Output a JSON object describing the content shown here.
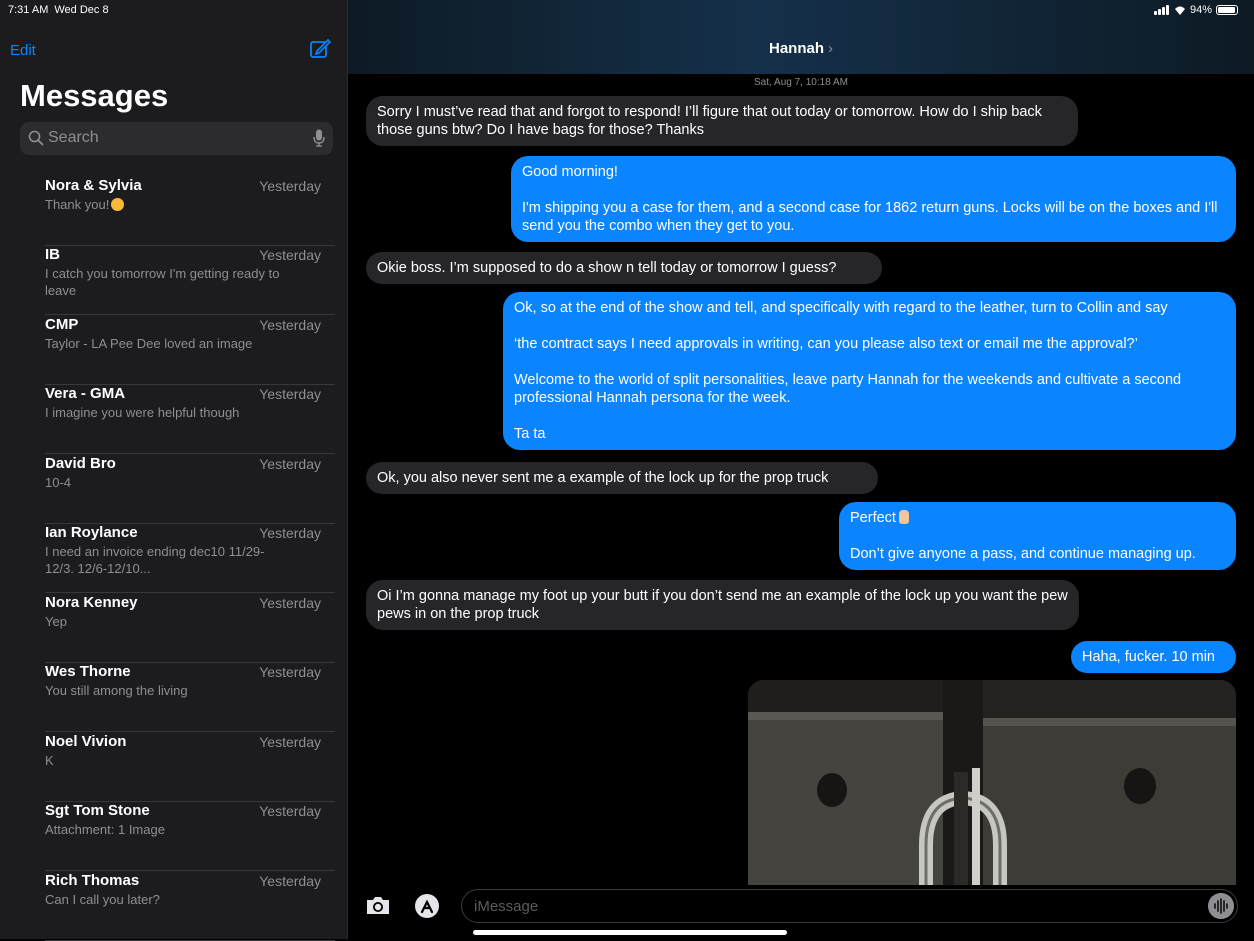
{
  "status": {
    "time": "7:31 AM",
    "date": "Wed Dec 8",
    "battery": "94%",
    "battery_level": 0.94
  },
  "sidebar": {
    "edit_label": "Edit",
    "title": "Messages",
    "search_placeholder": "Search",
    "conversations": [
      {
        "name": "Nora & Sylvia",
        "time": "Yesterday",
        "preview": "Thank you!"
      },
      {
        "name": "IB",
        "time": "Yesterday",
        "preview": "I catch you tomorrow I'm getting ready to leave"
      },
      {
        "name": "CMP",
        "time": "Yesterday",
        "preview": "Taylor - LA Pee Dee loved an image"
      },
      {
        "name": "Vera - GMA",
        "time": "Yesterday",
        "preview": "I imagine you were helpful though"
      },
      {
        "name": "David Bro",
        "time": "Yesterday",
        "preview": "10-4"
      },
      {
        "name": "Ian Roylance",
        "time": "Yesterday",
        "preview": "I need an invoice ending dec10 11/29-12/3. 12/6-12/10..."
      },
      {
        "name": "Nora Kenney",
        "time": "Yesterday",
        "preview": "Yep"
      },
      {
        "name": "Wes Thorne",
        "time": "Yesterday",
        "preview": "You still among the living"
      },
      {
        "name": "Noel Vivion",
        "time": "Yesterday",
        "preview": "K"
      },
      {
        "name": "Sgt Tom Stone",
        "time": "Yesterday",
        "preview": "Attachment: 1 Image"
      },
      {
        "name": "Rich Thomas",
        "time": "Yesterday",
        "preview": "Can I call you later?"
      }
    ]
  },
  "chat": {
    "contact": "Hannah",
    "chevron": "›",
    "timestamp": "Sat, Aug 7, 10:18 AM",
    "messages": [
      {
        "dir": "in",
        "paras": [
          "Sorry I must’ve read that and forgot to respond! I’ll figure that out today or tomorrow. How do I ship back those guns btw? Do I have bags for those? Thanks"
        ]
      },
      {
        "dir": "out",
        "paras": [
          "Good morning!",
          "I'm shipping you a case for them, and a second case for 1862 return guns. Locks will be on the boxes and I'll send you the combo when they get to you."
        ]
      },
      {
        "dir": "in",
        "paras": [
          "Okie boss. I’m supposed to do a show n tell today or tomorrow I guess?"
        ]
      },
      {
        "dir": "out",
        "paras": [
          "Ok, so at the end of the show and tell, and specifically with regard to the leather, turn to Collin and say",
          "‘the contract says I need approvals in writing, can you please also text or email me the approval?’",
          "Welcome to the world of split personalities, leave party Hannah for the weekends and cultivate a second professional Hannah persona for the week.",
          "Ta ta"
        ]
      },
      {
        "dir": "in",
        "paras": [
          "Ok, you also never sent me a example of the lock up for the prop truck"
        ]
      },
      {
        "dir": "out",
        "paras": [
          "Perfect",
          "Don’t give anyone a pass, and continue managing up."
        ]
      },
      {
        "dir": "in",
        "paras": [
          "Oi I’m gonna manage my foot up your butt if you don’t send me an example of the lock up you want the pew pews in on the prop truck"
        ]
      },
      {
        "dir": "out",
        "paras": [
          "Haha, fucker. 10 min"
        ]
      }
    ],
    "input_placeholder": "iMessage"
  }
}
